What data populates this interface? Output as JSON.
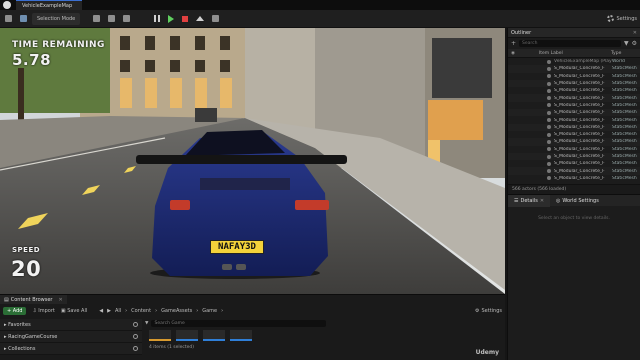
{
  "window": {
    "map_tab": "VehicleExampleMap"
  },
  "toolbar": {
    "selection_mode": "Selection Mode",
    "settings": "Settings"
  },
  "hud": {
    "time_label": "TIME REMAINING",
    "time_value": "5.78",
    "speed_label": "SPEED",
    "speed_value": "20",
    "license_plate": "NAFAY3D"
  },
  "outliner": {
    "title": "Outliner",
    "search_placeholder": "Search",
    "col_label": "Item Label",
    "col_type": "Type",
    "rows": [
      {
        "name": "VehicleExampleMap (Play In Editor)",
        "type": "World"
      },
      {
        "name": "S_Modular_Concrete_F",
        "type": "StaticMesh"
      },
      {
        "name": "S_Modular_Concrete_F",
        "type": "StaticMesh"
      },
      {
        "name": "S_Modular_Concrete_F",
        "type": "StaticMesh"
      },
      {
        "name": "S_Modular_Concrete_F",
        "type": "StaticMesh"
      },
      {
        "name": "S_Modular_Concrete_F",
        "type": "StaticMesh"
      },
      {
        "name": "S_Modular_Concrete_F",
        "type": "StaticMesh"
      },
      {
        "name": "S_Modular_Concrete_F",
        "type": "StaticMesh"
      },
      {
        "name": "S_Modular_Concrete_F",
        "type": "StaticMesh"
      },
      {
        "name": "S_Modular_Concrete_F",
        "type": "StaticMesh"
      },
      {
        "name": "S_Modular_Concrete_F",
        "type": "StaticMesh"
      },
      {
        "name": "S_Modular_Concrete_F",
        "type": "StaticMesh"
      },
      {
        "name": "S_Modular_Concrete_F",
        "type": "StaticMesh"
      },
      {
        "name": "S_Modular_Concrete_F",
        "type": "StaticMesh"
      },
      {
        "name": "S_Modular_Concrete_F",
        "type": "StaticMesh"
      },
      {
        "name": "S_Modular_Concrete_F",
        "type": "StaticMesh"
      },
      {
        "name": "S_Modular_Concrete_F",
        "type": "StaticMesh"
      }
    ],
    "footer": "566 actors (566 loaded)"
  },
  "details": {
    "tab_details": "Details",
    "tab_world": "World Settings",
    "hint": "Select an object to view details."
  },
  "content_browser": {
    "tab": "Content Browser",
    "add": "+ Add",
    "import": "Import",
    "save_all": "Save All",
    "crumbs": [
      "All",
      "Content",
      "GameAssets",
      "Game"
    ],
    "settings": "Settings",
    "sections": [
      "Favorites",
      "RacingGameCourse",
      "Collections"
    ],
    "search_placeholder": "Search Game",
    "count": "4 items (1 selected)"
  },
  "watermark": "Udemy"
}
